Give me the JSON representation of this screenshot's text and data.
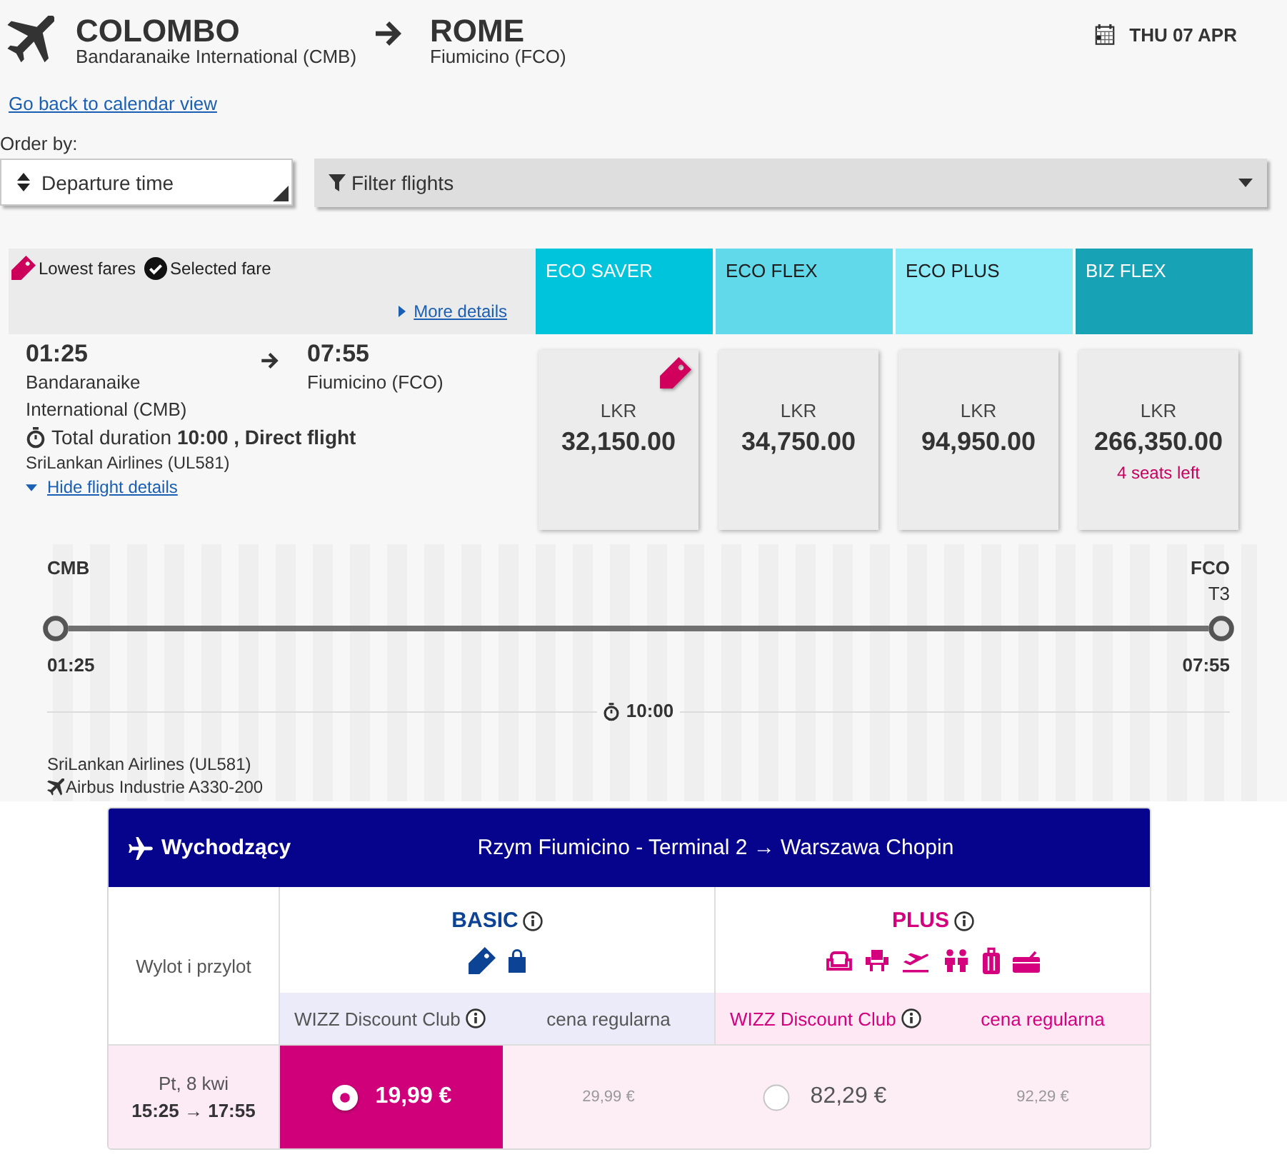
{
  "route": {
    "origin": {
      "city": "COLOMBO",
      "airport": "Bandaranaike International (CMB)"
    },
    "destination": {
      "city": "ROME",
      "airport": "Fiumicino (FCO)"
    },
    "date": "THU 07 APR"
  },
  "back_link": "Go back to calendar view",
  "order_by": {
    "label": "Order by:",
    "value": "Departure time"
  },
  "filter": {
    "label": "Filter flights"
  },
  "legend": [
    {
      "kind": "lowest",
      "label": "Lowest fares"
    },
    {
      "kind": "selected",
      "label": "Selected fare"
    }
  ],
  "more_details": "More details",
  "fare_classes": [
    {
      "name": "ECO SAVER",
      "color": "#00c3dc"
    },
    {
      "name": "ECO FLEX",
      "color": "#62d9ea"
    },
    {
      "name": "ECO PLUS",
      "color": "#8eebf8"
    },
    {
      "name": "BIZ FLEX",
      "color": "#18a2b5"
    }
  ],
  "flight": {
    "departure_time": "01:25",
    "departure_airport": "Bandaranaike International (CMB)",
    "arrival_time": "07:55",
    "arrival_airport": "Fiumicino (FCO)",
    "duration": "Total duration **10:00 , Direct flight**",
    "airline": "SriLankan Airlines (UL581)",
    "details_toggle": "Hide flight details",
    "expanded": true,
    "fares": [
      {
        "currency": "LKR",
        "price": "32,150.00",
        "lowest": true,
        "selected": false
      },
      {
        "currency": "LKR",
        "price": "34,750.00",
        "lowest": false,
        "selected": false
      },
      {
        "currency": "LKR",
        "price": "94,950.00",
        "lowest": false,
        "selected": false
      },
      {
        "currency": "LKR",
        "price": "266,350.00",
        "note": "4 seats left",
        "lowest": false,
        "selected": false
      }
    ]
  },
  "details": {
    "origin_code": "CMB",
    "destination_code": "FCO",
    "destination_terminal": "T3",
    "departure_time": "01:25",
    "arrival_time": "07:55",
    "duration": "10:00",
    "airline": "SriLankan Airlines (UL581)",
    "aircraft": "Airbus Industrie A330-200"
  },
  "wizz": {
    "direction": "Wychodzący",
    "route": "Rzym Fiumicino - Terminal 2 → Warszawa Chopin",
    "row_header": "Wylot i przylot",
    "bundles": [
      {
        "kind": "basic",
        "name": "BASIC",
        "color": "#0d4394",
        "discount_label": "WIZZ Discount Club",
        "regular_label": "cena regularna"
      },
      {
        "kind": "plus",
        "name": "PLUS",
        "color": "#d4007e",
        "discount_label": "WIZZ Discount Club",
        "regular_label": "cena regularna"
      }
    ],
    "flights": [
      {
        "date": "Pt, 8 kwi",
        "times": "15:25 → 17:55",
        "prices": [
          {
            "discount": "19,99 €",
            "regular": "29,99 €",
            "selected": true
          },
          {
            "discount": "82,29 €",
            "regular": "92,29 €",
            "selected": false
          }
        ]
      }
    ]
  }
}
